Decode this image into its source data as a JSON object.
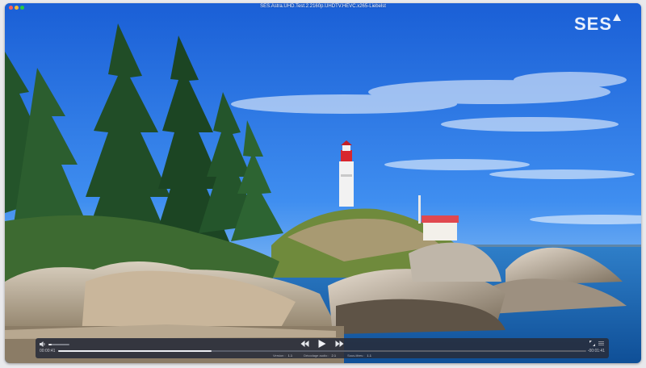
{
  "window": {
    "title": "SES.Astra.UHD.Test.2.2160p.UHDTV.HEVC.x265-Liebelst"
  },
  "overlay": {
    "logo_text": "SES",
    "logo_icon": "triangle-icon"
  },
  "player": {
    "time_current": "00:00:41",
    "time_remaining": "-00:01:41",
    "progress": 0.29,
    "volume": 0.15,
    "tracks": [
      {
        "label": "Version :",
        "value": "1.1"
      },
      {
        "label": "Décodage audio :",
        "value": "2.1"
      },
      {
        "label": "Sous-titres :",
        "value": "1.1"
      }
    ]
  },
  "colors": {
    "sky": "#1f66d8",
    "control_bg": "#282c3a"
  }
}
